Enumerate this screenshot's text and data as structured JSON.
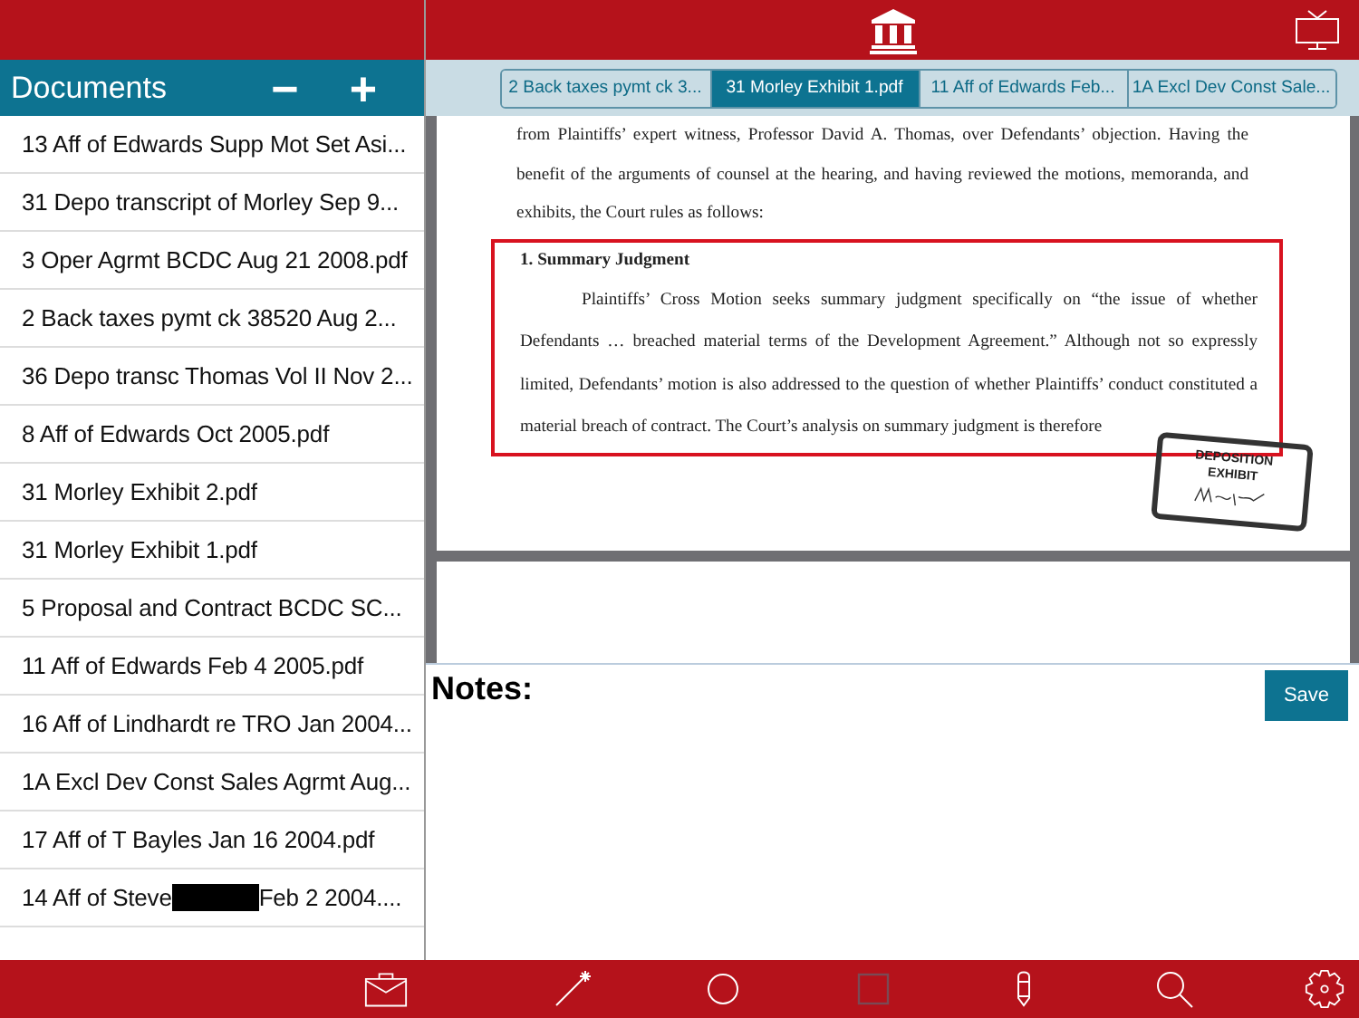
{
  "documents_panel": {
    "title": "Documents",
    "remove_label": "−",
    "add_label": "+",
    "items": [
      {
        "label": "13 Aff of Edwards Supp Mot Set Asi...",
        "redacted": false
      },
      {
        "label": "31 Depo transcript of Morley Sep 9...",
        "redacted": false
      },
      {
        "label": "3 Oper Agrmt BCDC Aug 21 2008.pdf",
        "redacted": false
      },
      {
        "label": "2 Back taxes pymt ck 38520 Aug 2...",
        "redacted": false
      },
      {
        "label": "36 Depo transc Thomas Vol II Nov 2...",
        "redacted": false
      },
      {
        "label": "8 Aff of Edwards Oct 2005.pdf",
        "redacted": false
      },
      {
        "label": "31 Morley Exhibit 2.pdf",
        "redacted": false
      },
      {
        "label": "31 Morley Exhibit 1.pdf",
        "redacted": false
      },
      {
        "label": "5 Proposal and Contract BCDC SC...",
        "redacted": false
      },
      {
        "label": "11 Aff of Edwards Feb 4 2005.pdf",
        "redacted": false
      },
      {
        "label": "16 Aff of Lindhardt re TRO Jan 2004...",
        "redacted": false
      },
      {
        "label": "1A Excl Dev Const Sales Agrmt Aug...",
        "redacted": false
      },
      {
        "label": "17 Aff of T Bayles Jan 16 2004.pdf",
        "redacted": false
      },
      {
        "label": "14 Aff of Steve",
        "redacted": true,
        "label_after": "Feb 2 2004...."
      }
    ]
  },
  "open_tabs": [
    {
      "label": "2 Back taxes pymt ck 3...",
      "selected": false
    },
    {
      "label": "31 Morley Exhibit 1.pdf",
      "selected": true
    },
    {
      "label": "11 Aff of Edwards Feb...",
      "selected": false
    },
    {
      "label": "1A Excl Dev Const Sale...",
      "selected": false
    }
  ],
  "document": {
    "intro": "from Plaintiffs’ expert witness, Professor David A. Thomas, over Defendants’ objection.  Having the benefit of the arguments of counsel at the hearing, and having reviewed the motions, memoranda, and exhibits, the Court rules as follows:",
    "highlight": {
      "heading": "1.  Summary Judgment",
      "paragraph": "Plaintiffs’ Cross Motion seeks summary judgment specifically on “the issue of whether Defendants … breached material terms of the Development Agreement.” Although not so expressly limited, Defendants’ motion is also addressed to the question of whether Plaintiffs’ conduct constituted a material breach of contract.  The Court’s analysis on summary judgment is therefore"
    },
    "stamp": {
      "title": "DEPOSITION",
      "subtitle": "EXHIBIT"
    }
  },
  "notes": {
    "label": "Notes:",
    "save_label": "Save"
  }
}
